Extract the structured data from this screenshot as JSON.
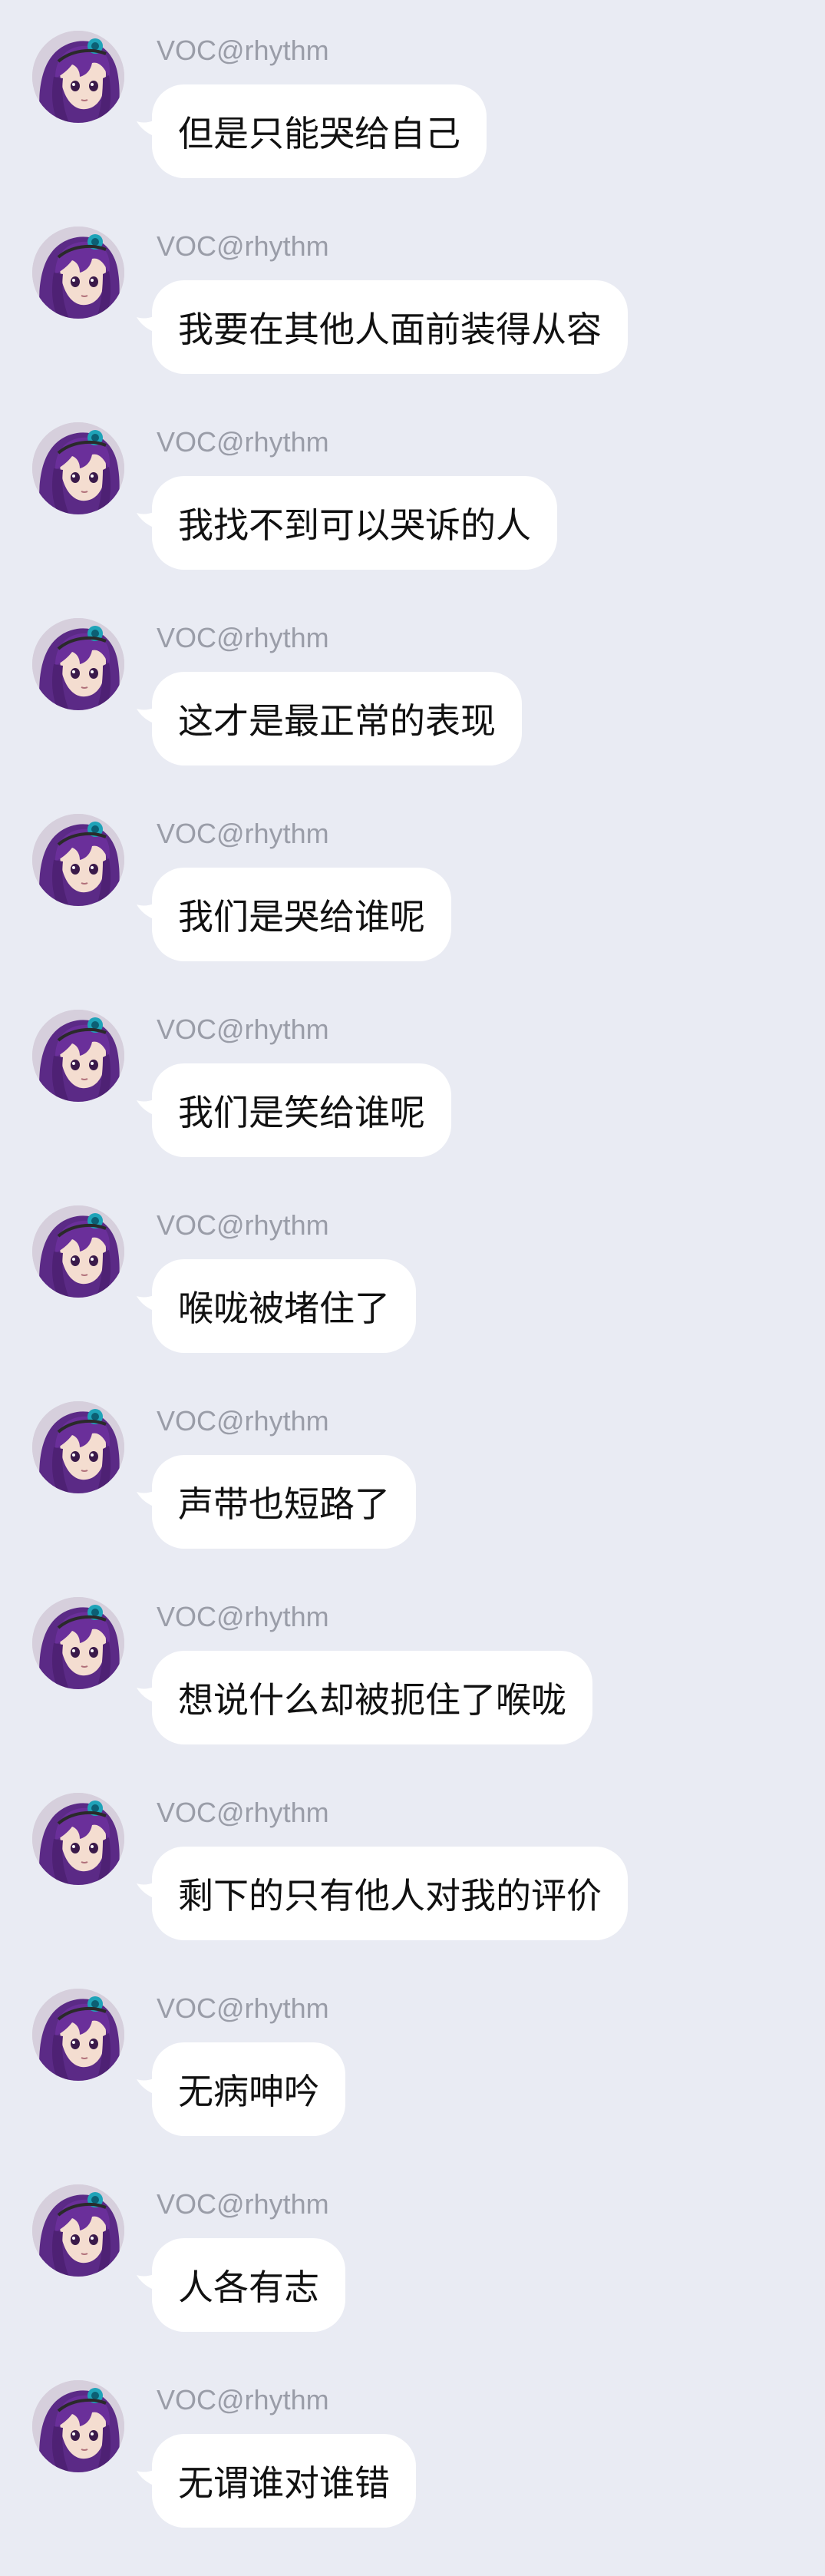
{
  "conversation": {
    "messages": [
      {
        "sender": "VOC@rhythm",
        "text": "但是只能哭给自己"
      },
      {
        "sender": "VOC@rhythm",
        "text": "我要在其他人面前装得从容"
      },
      {
        "sender": "VOC@rhythm",
        "text": "我找不到可以哭诉的人"
      },
      {
        "sender": "VOC@rhythm",
        "text": "这才是最正常的表现"
      },
      {
        "sender": "VOC@rhythm",
        "text": "我们是哭给谁呢"
      },
      {
        "sender": "VOC@rhythm",
        "text": "我们是笑给谁呢"
      },
      {
        "sender": "VOC@rhythm",
        "text": "喉咙被堵住了"
      },
      {
        "sender": "VOC@rhythm",
        "text": "声带也短路了"
      },
      {
        "sender": "VOC@rhythm",
        "text": "想说什么却被扼住了喉咙"
      },
      {
        "sender": "VOC@rhythm",
        "text": "剩下的只有他人对我的评价"
      },
      {
        "sender": "VOC@rhythm",
        "text": "无病呻吟"
      },
      {
        "sender": "VOC@rhythm",
        "text": "人各有志"
      },
      {
        "sender": "VOC@rhythm",
        "text": "无谓谁对谁错"
      }
    ]
  },
  "avatar_icon": "anime-girl-purple-hair-avatar",
  "colors": {
    "background": "#e9ebf3",
    "bubble": "#ffffff",
    "sender_text": "#9a9da8",
    "message_text": "#111111"
  }
}
